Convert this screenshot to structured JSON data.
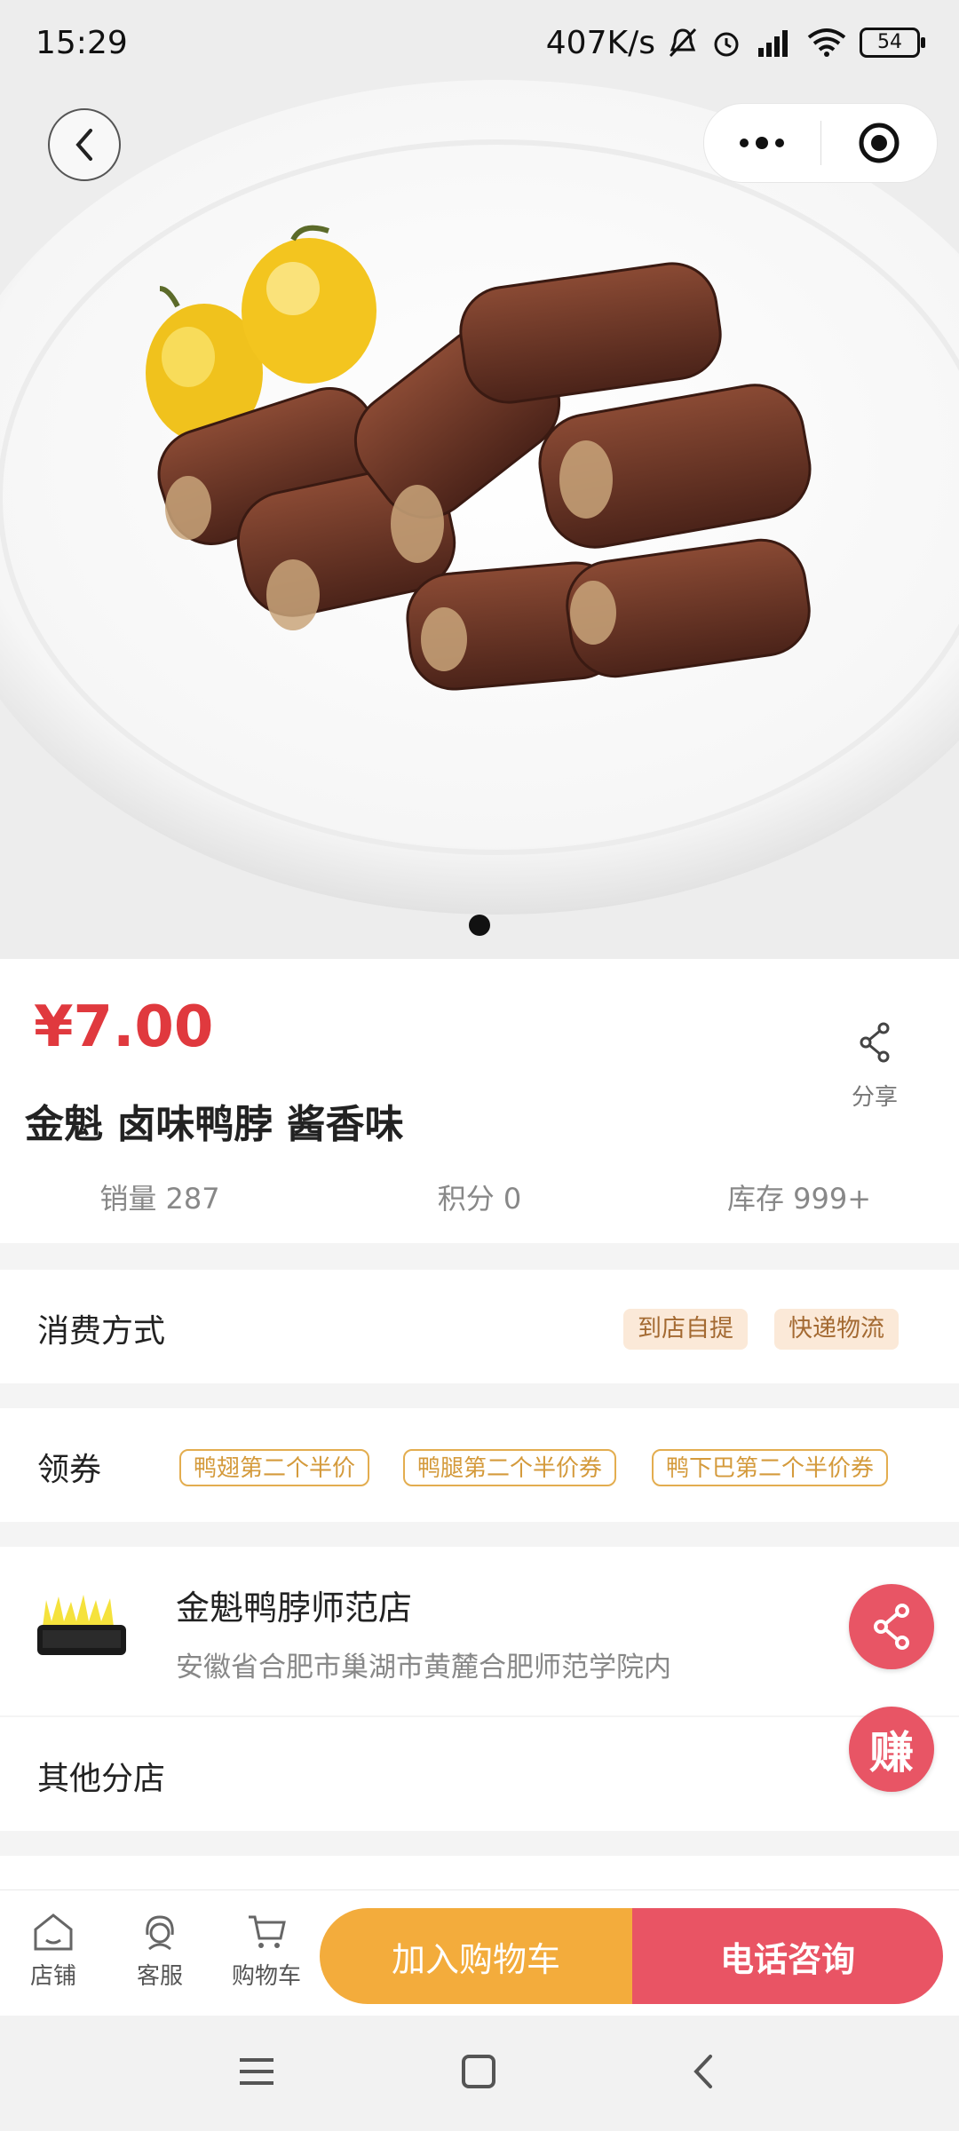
{
  "status_bar": {
    "time": "15:29",
    "speed": "407K/s",
    "battery": "54"
  },
  "product": {
    "price": "¥7.00",
    "title": "金魁 卤味鸭脖 酱香味",
    "share_label": "分享",
    "stats": [
      {
        "label": "销量 287"
      },
      {
        "label": "积分 0"
      },
      {
        "label": "库存 999+"
      }
    ]
  },
  "consumption": {
    "label": "消费方式",
    "options": [
      "到店自提",
      "快递物流"
    ]
  },
  "coupons": {
    "label": "领券",
    "items": [
      "鸭翅第二个半价",
      "鸭腿第二个半价券",
      "鸭下巴第二个半价券"
    ]
  },
  "store": {
    "name": "金魁鸭脖师范店",
    "address": "安徽省合肥市巢湖市黄麓合肥师范学院内",
    "other_branches": "其他分店"
  },
  "fab": {
    "earn_label": "赚"
  },
  "bottom_nav": {
    "items": [
      {
        "label": "店铺",
        "icon": "store-icon"
      },
      {
        "label": "客服",
        "icon": "customer-service-icon"
      },
      {
        "label": "购物车",
        "icon": "cart-icon"
      }
    ],
    "add_to_cart": "加入购物车",
    "phone_consult": "电话咨询"
  },
  "colors": {
    "price": "#e0393e",
    "cart_button": "#f3ac3c",
    "call_button": "#e95464"
  }
}
